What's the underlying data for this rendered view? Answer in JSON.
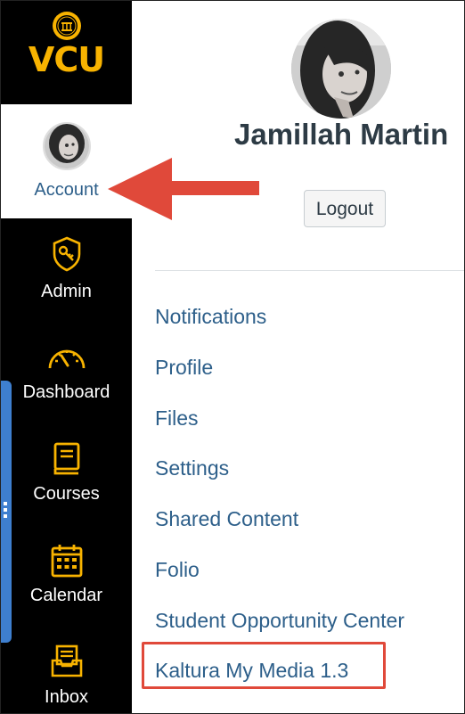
{
  "logo": {
    "text": "VCU"
  },
  "nav": {
    "account": "Account",
    "items": [
      {
        "label": "Admin",
        "icon": "shield-key-icon"
      },
      {
        "label": "Dashboard",
        "icon": "speedometer-icon"
      },
      {
        "label": "Courses",
        "icon": "book-icon"
      },
      {
        "label": "Calendar",
        "icon": "calendar-icon"
      },
      {
        "label": "Inbox",
        "icon": "inbox-icon"
      }
    ]
  },
  "tray": {
    "user_name": "Jamillah Martin",
    "logout_label": "Logout",
    "links": [
      "Notifications",
      "Profile",
      "Files",
      "Settings",
      "Shared Content",
      "Folio",
      "Student Opportunity Center",
      "Kaltura My Media 1.3"
    ]
  },
  "colors": {
    "nav_bg": "#000000",
    "nav_icon": "#f8b300",
    "link": "#2d5f8a",
    "annotation": "#e0493a",
    "handle": "#3e7fcf"
  }
}
